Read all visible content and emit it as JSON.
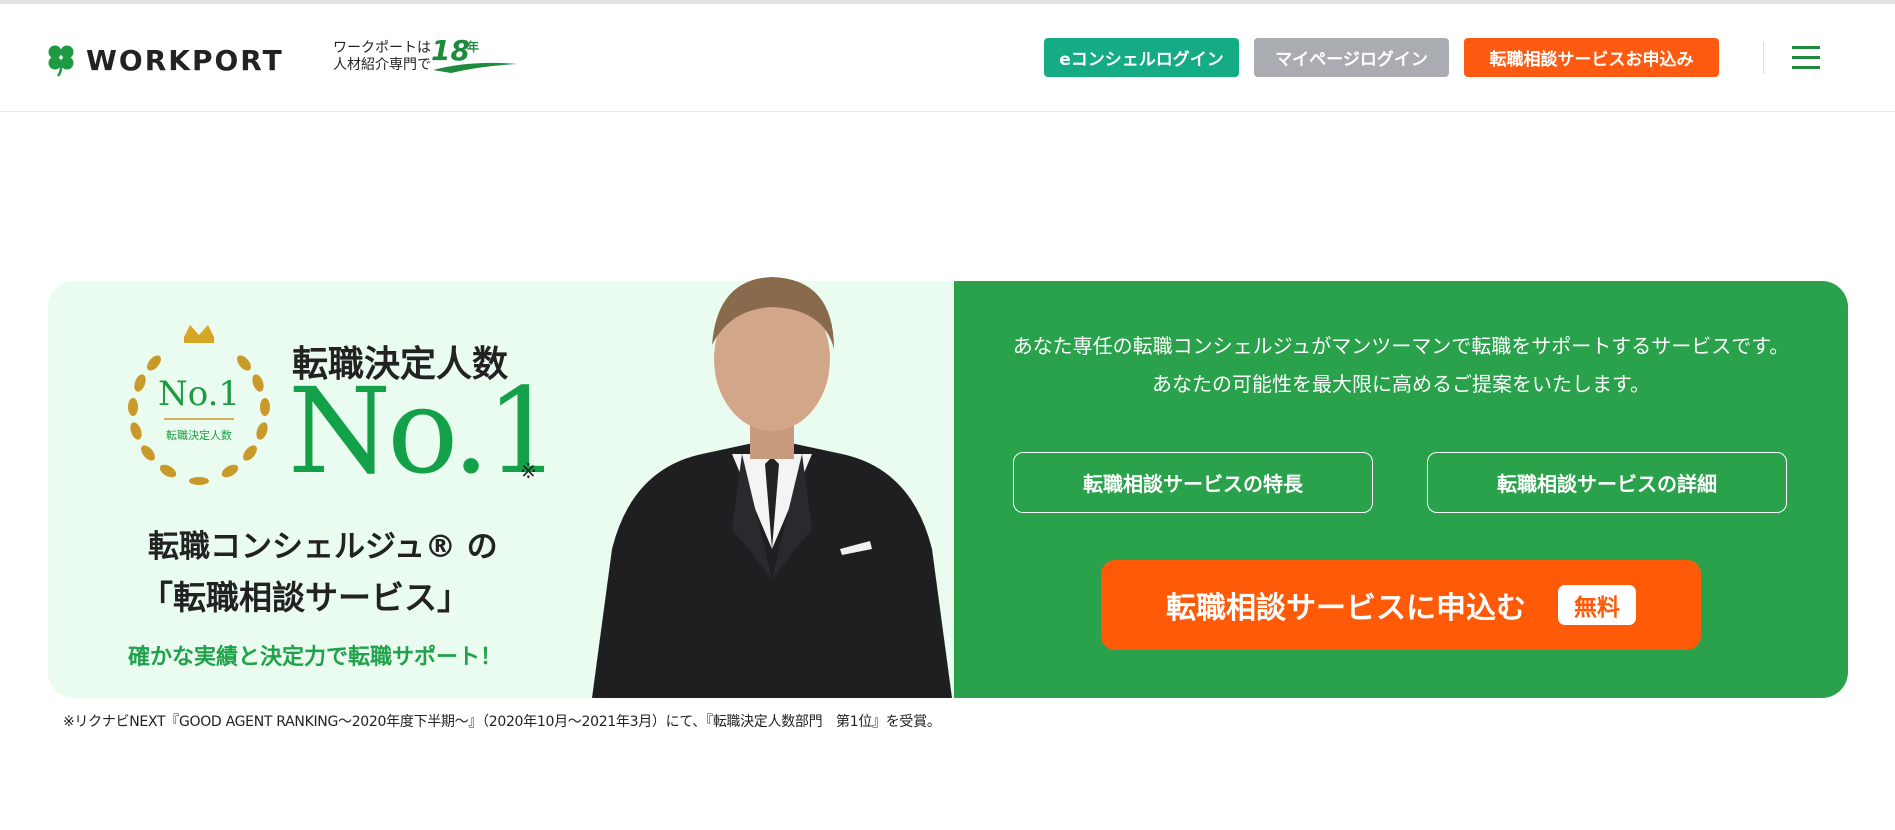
{
  "header": {
    "logo_text": "WORKPORT",
    "tagline_line1": "ワークポートは",
    "tagline_line2": "人材紹介専門で",
    "years_number": "18",
    "years_unit": "年",
    "econcierge_login": "eコンシェルログイン",
    "mypage_login": "マイページログイン",
    "apply_service": "転職相談サービスお申込み"
  },
  "hero": {
    "badge_main": "No.1",
    "badge_sub": "転職決定人数",
    "title": "転職決定人数",
    "big_text": "No.1",
    "asterisk": "※",
    "line1": "転職コンシェルジュ® の",
    "line2": "「転職相談サービス」",
    "line3": "確かな実績と決定力で転職サポート！",
    "desc_line1": "あなた専任の転職コンシェルジュがマンツーマンで転職をサポートするサービスです。",
    "desc_line2": "あなたの可能性を最大限に高めるご提案をいたします。",
    "features_button": "転職相談サービスの特長",
    "details_button": "転職相談サービスの詳細",
    "cta_label": "転職相談サービスに申込む",
    "cta_badge": "無料"
  },
  "footnote": "※リクナビNEXT『GOOD AGENT RANKING～2020年度下半期～』（2020年10月～2021年3月）にて、『転職決定人数部門　第1位』を受賞。",
  "colors": {
    "brand_green": "#2aa24b",
    "teal": "#15ab85",
    "gray_button": "#a9adb1",
    "orange": "#ff5a12",
    "mint_bg": "#eafbf0"
  }
}
